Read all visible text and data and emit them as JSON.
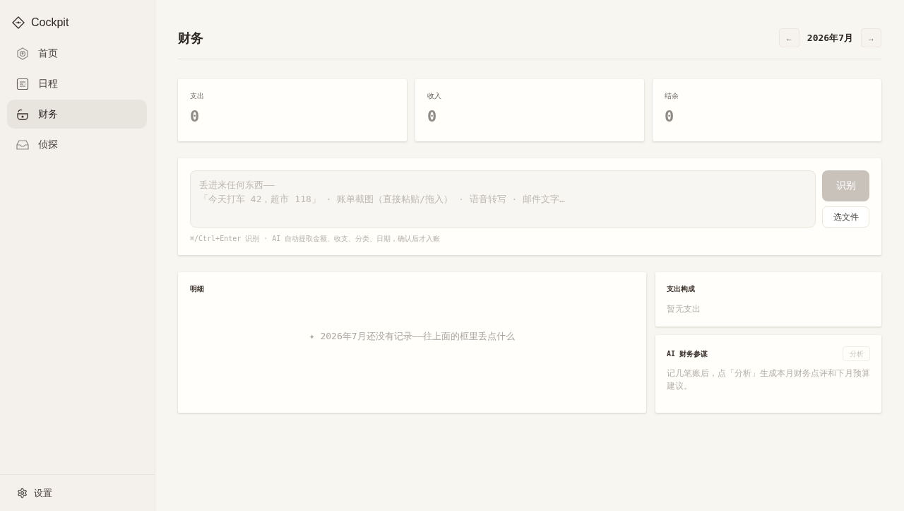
{
  "sidebar": {
    "brand": "Cockpit",
    "items": [
      {
        "label": "首页",
        "selected": false
      },
      {
        "label": "日程",
        "selected": false
      },
      {
        "label": "财务",
        "selected": true
      },
      {
        "label": "侦探",
        "selected": false
      }
    ],
    "footer": {
      "label": "设置"
    }
  },
  "header": {
    "title": "财务",
    "prev": "←",
    "month": "2026年7月",
    "next": "→"
  },
  "stats": [
    {
      "label": "支出",
      "value": "0"
    },
    {
      "label": "收入",
      "value": "0"
    },
    {
      "label": "结余",
      "value": "0"
    }
  ],
  "capture": {
    "placeholder": "丢进来任何东西——\n「今天打车 42，超市 118」 · 账单截图（直接粘贴/拖入） · 语音转写 · 邮件文字…",
    "recognize_button": {
      "label": "识别",
      "disabled": true
    },
    "file_button": {
      "label": "选文件"
    },
    "hint": "⌘/Ctrl+Enter 识别 · AI 自动提取金额、收支、分类、日期，确认后才入账"
  },
  "details": {
    "title": "明细",
    "empty": "✦ 2026年7月还没有记录——往上面的框里丢点什么"
  },
  "breakdown": {
    "title": "支出构成",
    "empty": "暂无支出"
  },
  "advisor": {
    "title": "AI 财务参谋",
    "analyze_button": {
      "label": "分析",
      "disabled": true
    },
    "note": "记几笔账后，点「分析」生成本月财务点评和下月预算建议。"
  }
}
